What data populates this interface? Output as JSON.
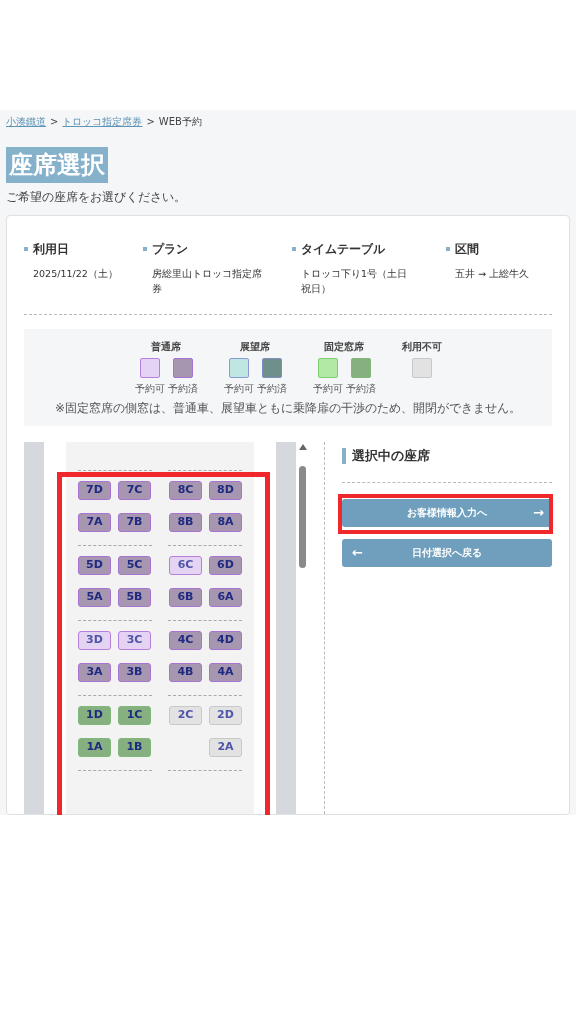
{
  "breadcrumb": [
    {
      "kind": "link",
      "label": "小湊鐵道"
    },
    {
      "kind": "separator",
      "label": ">"
    },
    {
      "kind": "link",
      "label": "トロッコ指定席券"
    },
    {
      "kind": "separator",
      "label": ">"
    },
    {
      "kind": "current",
      "label": "WEB予約"
    }
  ],
  "title": "座席選択",
  "intro": "ご希望の座席をお選びください。",
  "summary": [
    {
      "label": "利用日",
      "value": "2025/11/22（土）"
    },
    {
      "label": "プラン",
      "value": "房総里山トロッコ指定席券"
    },
    {
      "label": "タイムテーブル",
      "value": "トロッコ下り1号（土日祝日）"
    },
    {
      "label": "区間",
      "value": "五井 → 上総牛久"
    }
  ],
  "legend": {
    "groups": [
      {
        "label": "普通席",
        "kind": "normal",
        "boxes": [
          {
            "reserved": false,
            "caption": "予約可"
          },
          {
            "reserved": true,
            "caption": "予約済"
          }
        ]
      },
      {
        "label": "展望席",
        "kind": "panorama",
        "boxes": [
          {
            "reserved": false,
            "caption": "予約可"
          },
          {
            "reserved": true,
            "caption": "予約済"
          }
        ]
      },
      {
        "label": "固定窓席",
        "kind": "fixed",
        "boxes": [
          {
            "reserved": false,
            "caption": "予約可"
          },
          {
            "reserved": true,
            "caption": "予約済"
          }
        ]
      },
      {
        "label": "利用不可",
        "kind": "blocked",
        "boxes": [
          {
            "reserved": false
          }
        ]
      }
    ],
    "note": "※固定窓席の側窓は、普通車、展望車ともに乗降扉の干渉のため、開閉ができません。"
  },
  "seat_blocks": [
    {
      "rows": [
        {
          "left": [
            {
              "label": "7D",
              "kind": "normal",
              "reserved": true
            },
            {
              "label": "7C",
              "kind": "normal",
              "reserved": true
            }
          ],
          "right": [
            {
              "label": "8C",
              "kind": "normal",
              "reserved": true
            },
            {
              "label": "8D",
              "kind": "normal",
              "reserved": true
            }
          ]
        },
        {
          "left": [
            {
              "label": "7A",
              "kind": "normal",
              "reserved": true
            },
            {
              "label": "7B",
              "kind": "normal",
              "reserved": true
            }
          ],
          "right": [
            {
              "label": "8B",
              "kind": "normal",
              "reserved": true
            },
            {
              "label": "8A",
              "kind": "normal",
              "reserved": true
            }
          ]
        }
      ]
    },
    {
      "rows": [
        {
          "left": [
            {
              "label": "5D",
              "kind": "normal",
              "reserved": true
            },
            {
              "label": "5C",
              "kind": "normal",
              "reserved": true
            }
          ],
          "right": [
            {
              "label": "6C",
              "kind": "normal",
              "reserved": false
            },
            {
              "label": "6D",
              "kind": "normal",
              "reserved": true
            }
          ]
        },
        {
          "left": [
            {
              "label": "5A",
              "kind": "normal",
              "reserved": true
            },
            {
              "label": "5B",
              "kind": "normal",
              "reserved": true
            }
          ],
          "right": [
            {
              "label": "6B",
              "kind": "normal",
              "reserved": true
            },
            {
              "label": "6A",
              "kind": "normal",
              "reserved": true
            }
          ]
        }
      ]
    },
    {
      "rows": [
        {
          "left": [
            {
              "label": "3D",
              "kind": "normal",
              "reserved": false
            },
            {
              "label": "3C",
              "kind": "normal",
              "reserved": false
            }
          ],
          "right": [
            {
              "label": "4C",
              "kind": "normal",
              "reserved": true
            },
            {
              "label": "4D",
              "kind": "normal",
              "reserved": true
            }
          ]
        },
        {
          "left": [
            {
              "label": "3A",
              "kind": "normal",
              "reserved": true
            },
            {
              "label": "3B",
              "kind": "normal",
              "reserved": true
            }
          ],
          "right": [
            {
              "label": "4B",
              "kind": "normal",
              "reserved": true
            },
            {
              "label": "4A",
              "kind": "normal",
              "reserved": true
            }
          ]
        }
      ]
    },
    {
      "rows": [
        {
          "left": [
            {
              "label": "1D",
              "kind": "fixed",
              "reserved": true
            },
            {
              "label": "1C",
              "kind": "fixed",
              "reserved": true
            }
          ],
          "right": [
            {
              "label": "2C",
              "kind": "blocked",
              "reserved": false
            },
            {
              "label": "2D",
              "kind": "blocked",
              "reserved": false
            }
          ]
        },
        {
          "left": [
            {
              "label": "1A",
              "kind": "fixed",
              "reserved": true
            },
            {
              "label": "1B",
              "kind": "fixed",
              "reserved": true
            }
          ],
          "right": [
            {
              "label": "2A",
              "kind": "blocked",
              "reserved": false
            }
          ]
        }
      ]
    }
  ],
  "selection": {
    "heading": "選択中の座席"
  },
  "buttons": [
    {
      "label": "お客様情報入力へ",
      "kind": "next",
      "icon": "→"
    },
    {
      "label": "日付選択へ戻る",
      "kind": "back",
      "icon": "←"
    }
  ]
}
